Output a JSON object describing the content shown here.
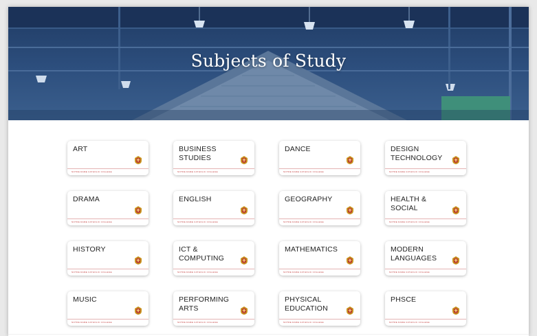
{
  "hero": {
    "title": "Subjects of Study"
  },
  "subjects": [
    {
      "label": "ART",
      "college": "NOTRE DAME CATHOLIC COLLEGE"
    },
    {
      "label": "BUSINESS STUDIES",
      "college": "NOTRE DAME CATHOLIC COLLEGE"
    },
    {
      "label": "DANCE",
      "college": "NOTRE DAME CATHOLIC COLLEGE"
    },
    {
      "label": "DESIGN TECHNOLOGY",
      "college": "NOTRE DAME CATHOLIC COLLEGE"
    },
    {
      "label": "DRAMA",
      "college": "NOTRE DAME CATHOLIC COLLEGE"
    },
    {
      "label": "ENGLISH",
      "college": "NOTRE DAME CATHOLIC COLLEGE"
    },
    {
      "label": "GEOGRAPHY",
      "college": "NOTRE DAME CATHOLIC COLLEGE"
    },
    {
      "label": "HEALTH & SOCIAL",
      "college": "NOTRE DAME CATHOLIC COLLEGE"
    },
    {
      "label": "HISTORY",
      "college": "NOTRE DAME CATHOLIC COLLEGE"
    },
    {
      "label": "ICT & COMPUTING",
      "college": "NOTRE DAME CATHOLIC COLLEGE"
    },
    {
      "label": "MATHEMATICS",
      "college": "NOTRE DAME CATHOLIC COLLEGE"
    },
    {
      "label": "MODERN LANGUAGES",
      "college": "NOTRE DAME CATHOLIC COLLEGE"
    },
    {
      "label": "MUSIC",
      "college": "NOTRE DAME CATHOLIC COLLEGE"
    },
    {
      "label": "PERFORMING ARTS",
      "college": "NOTRE DAME CATHOLIC COLLEGE"
    },
    {
      "label": "PHYSICAL EDUCATION",
      "college": "NOTRE DAME CATHOLIC COLLEGE"
    },
    {
      "label": "PHSCE",
      "college": "NOTRE DAME CATHOLIC COLLEGE"
    }
  ],
  "card_icon": "school-crest-icon",
  "colors": {
    "hero_blue": "#2d4f7e",
    "crest_gold": "#c9951f",
    "crest_red": "#b8322e",
    "footer_red": "#c23c3c"
  }
}
